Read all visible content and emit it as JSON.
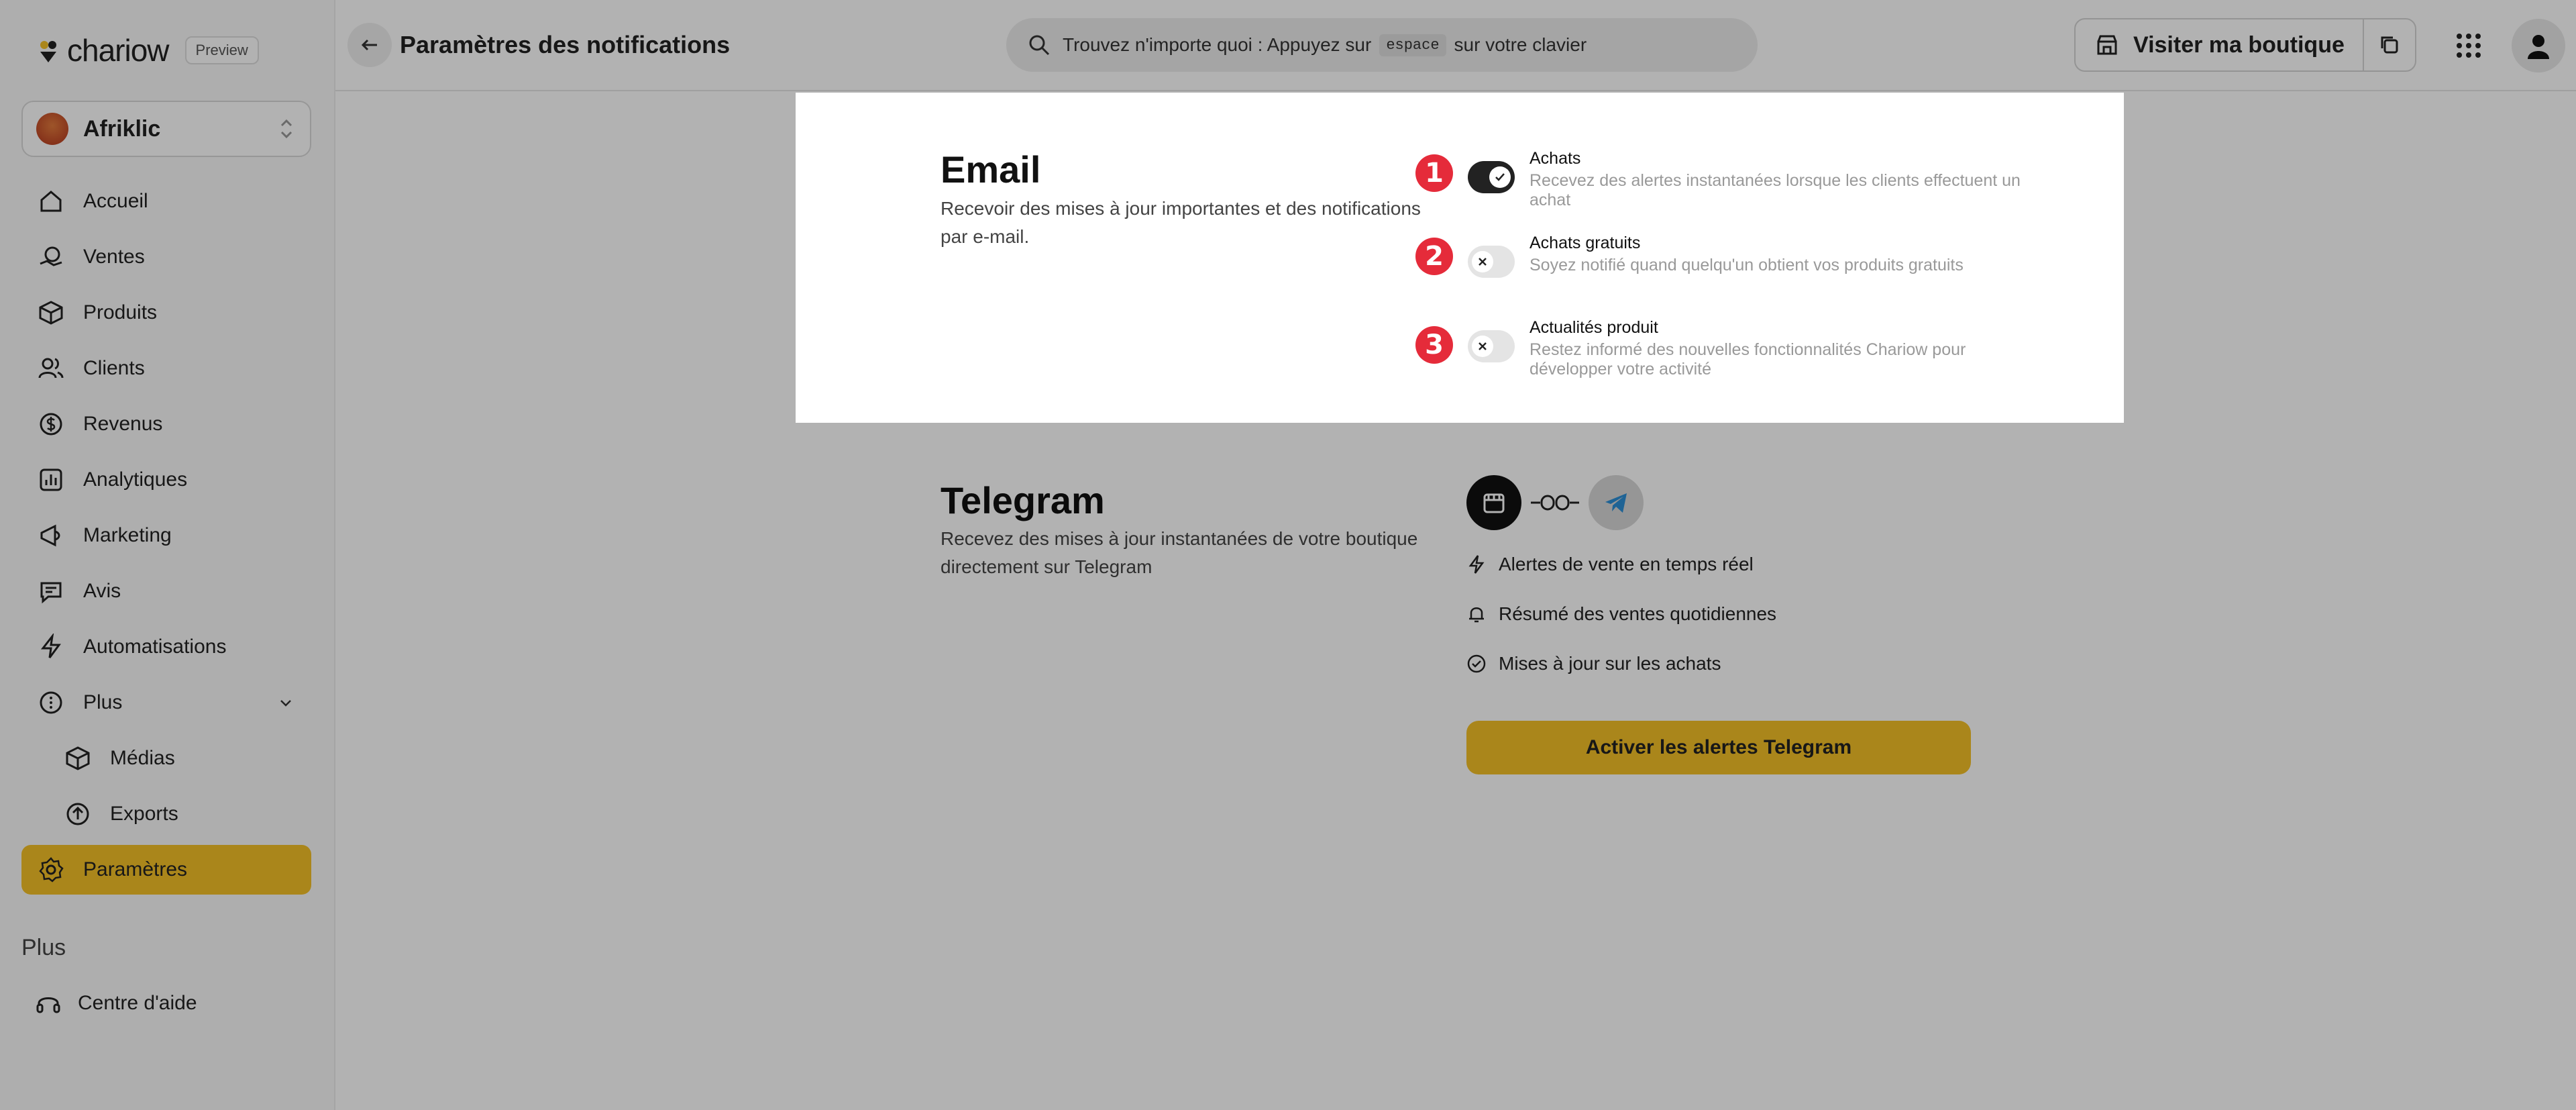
{
  "brand": {
    "name": "chariow",
    "badge": "Preview"
  },
  "store": {
    "name": "Afriklic"
  },
  "sidebar": {
    "items": [
      {
        "label": "Accueil",
        "icon": "home-icon"
      },
      {
        "label": "Ventes",
        "icon": "sales-icon"
      },
      {
        "label": "Produits",
        "icon": "box-icon"
      },
      {
        "label": "Clients",
        "icon": "users-icon"
      },
      {
        "label": "Revenus",
        "icon": "dollar-icon"
      },
      {
        "label": "Analytiques",
        "icon": "chart-icon"
      },
      {
        "label": "Marketing",
        "icon": "marketing-icon"
      },
      {
        "label": "Avis",
        "icon": "message-icon"
      },
      {
        "label": "Automatisations",
        "icon": "bolt-icon"
      },
      {
        "label": "Plus",
        "icon": "more-icon"
      },
      {
        "label": "Médias",
        "icon": "media-icon"
      },
      {
        "label": "Exports",
        "icon": "export-icon"
      },
      {
        "label": "Paramètres",
        "icon": "gear-icon",
        "active": true
      }
    ],
    "section_label": "Plus",
    "help_label": "Centre d'aide"
  },
  "header": {
    "title": "Paramètres des notifications",
    "search": {
      "prefix": "Trouvez n'importe quoi : Appuyez sur",
      "key": "espace",
      "suffix": "sur votre clavier"
    },
    "visit_label": "Visiter ma boutique"
  },
  "email": {
    "title": "Email",
    "description": "Recevoir des mises à jour importantes et des notifications par e-mail.",
    "preferences": [
      {
        "number": "1",
        "title": "Achats",
        "description": "Recevez des alertes instantanées lorsque les clients effectuent un achat",
        "enabled": true
      },
      {
        "number": "2",
        "title": "Achats gratuits",
        "description": "Soyez notifié quand quelqu'un obtient vos produits gratuits",
        "enabled": false
      },
      {
        "number": "3",
        "title": "Actualités produit",
        "description": "Restez informé des nouvelles fonctionnalités Chariow pour développer votre activité",
        "enabled": false
      }
    ]
  },
  "telegram": {
    "title": "Telegram",
    "description": "Recevez des mises à jour instantanées de votre boutique directement sur Telegram",
    "features": [
      "Alertes de vente en temps réel",
      "Résumé des ventes quotidiennes",
      "Mises à jour sur les achats"
    ],
    "button_label": "Activer les alertes Telegram"
  },
  "colors": {
    "accent": "#f4c028",
    "marker": "#e52b3a",
    "toggle_on": "#222222"
  }
}
